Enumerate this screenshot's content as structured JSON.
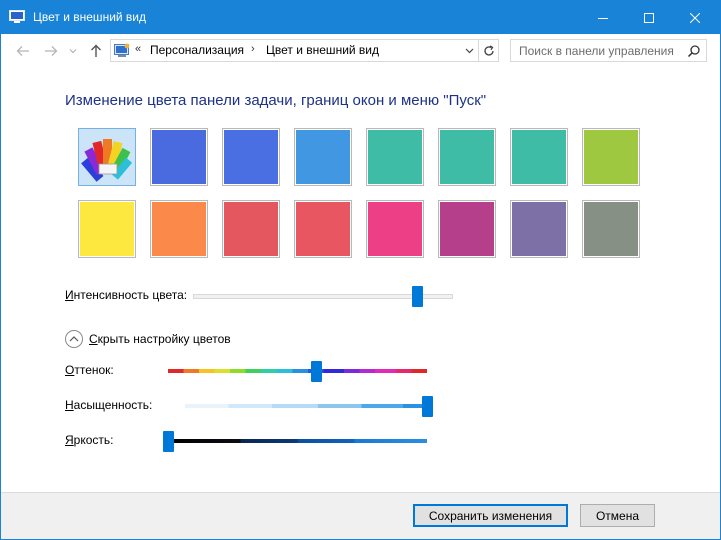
{
  "window": {
    "title": "Цвет и внешний вид",
    "accent_color": "#1883d7"
  },
  "nav": {
    "back_icon": "arrow-left-icon",
    "forward_icon": "arrow-right-icon",
    "recent_icon": "chevron-down-icon",
    "up_icon": "arrow-up-icon"
  },
  "address": {
    "overflow": "«",
    "crumbs": [
      "Персонализация",
      "Цвет и внешний вид"
    ],
    "separator": "›"
  },
  "search": {
    "placeholder": "Поиск в панели управления"
  },
  "main": {
    "heading": "Изменение цвета панели задачи, границ окон и меню \"Пуск\"",
    "swatches": [
      {
        "color": "automatic",
        "selected": true
      },
      {
        "color": "#4a6be0"
      },
      {
        "color": "#4a6fe3"
      },
      {
        "color": "#4197e1"
      },
      {
        "color": "#3fbca5"
      },
      {
        "color": "#3fbca5"
      },
      {
        "color": "#3fbca5"
      },
      {
        "color": "#9ec83f"
      },
      {
        "color": "#fde83f"
      },
      {
        "color": "#fb8a4a"
      },
      {
        "color": "#e5575f"
      },
      {
        "color": "#e85761"
      },
      {
        "color": "#ed3f85"
      },
      {
        "color": "#b63f8c"
      },
      {
        "color": "#7d70a6"
      },
      {
        "color": "#869084"
      }
    ],
    "intensity": {
      "label_u": "И",
      "label_rest": "нтенсивность цвета:",
      "value": 0.86
    },
    "toggle": {
      "label_u": "С",
      "label_rest": "крыть настройку цветов"
    },
    "hue": {
      "label_u": "О",
      "label_rest": "ттенок:",
      "value": 0.57
    },
    "saturation": {
      "label_u": "Н",
      "label_rest": "асыщенность:",
      "value": 1.0
    },
    "brightness": {
      "label_u": "Я",
      "label_rest": "ркость:",
      "value": 0.0
    }
  },
  "footer": {
    "save_label": "Сохранить изменения",
    "cancel_label": "Отмена"
  }
}
